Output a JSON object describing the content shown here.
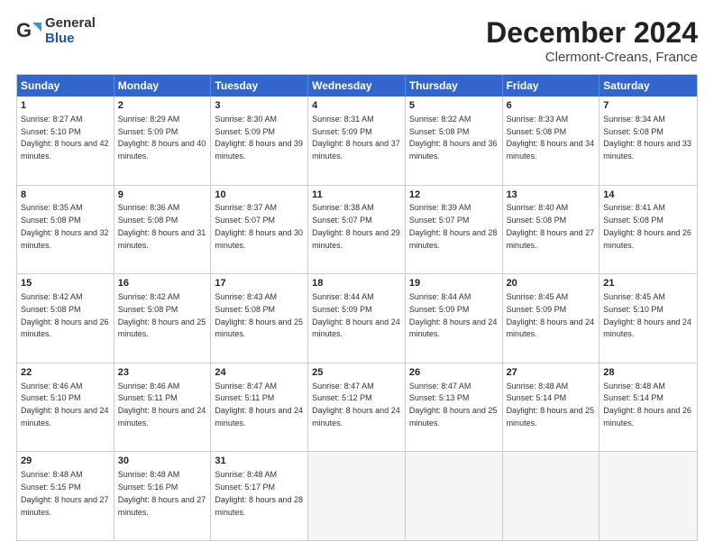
{
  "logo": {
    "general": "General",
    "blue": "Blue"
  },
  "title": "December 2024",
  "subtitle": "Clermont-Creans, France",
  "days": [
    "Sunday",
    "Monday",
    "Tuesday",
    "Wednesday",
    "Thursday",
    "Friday",
    "Saturday"
  ],
  "weeks": [
    [
      {
        "day": "1",
        "sunrise": "8:27 AM",
        "sunset": "5:10 PM",
        "daylight": "8 hours and 42 minutes."
      },
      {
        "day": "2",
        "sunrise": "8:29 AM",
        "sunset": "5:09 PM",
        "daylight": "8 hours and 40 minutes."
      },
      {
        "day": "3",
        "sunrise": "8:30 AM",
        "sunset": "5:09 PM",
        "daylight": "8 hours and 39 minutes."
      },
      {
        "day": "4",
        "sunrise": "8:31 AM",
        "sunset": "5:09 PM",
        "daylight": "8 hours and 37 minutes."
      },
      {
        "day": "5",
        "sunrise": "8:32 AM",
        "sunset": "5:08 PM",
        "daylight": "8 hours and 36 minutes."
      },
      {
        "day": "6",
        "sunrise": "8:33 AM",
        "sunset": "5:08 PM",
        "daylight": "8 hours and 34 minutes."
      },
      {
        "day": "7",
        "sunrise": "8:34 AM",
        "sunset": "5:08 PM",
        "daylight": "8 hours and 33 minutes."
      }
    ],
    [
      {
        "day": "8",
        "sunrise": "8:35 AM",
        "sunset": "5:08 PM",
        "daylight": "8 hours and 32 minutes."
      },
      {
        "day": "9",
        "sunrise": "8:36 AM",
        "sunset": "5:08 PM",
        "daylight": "8 hours and 31 minutes."
      },
      {
        "day": "10",
        "sunrise": "8:37 AM",
        "sunset": "5:07 PM",
        "daylight": "8 hours and 30 minutes."
      },
      {
        "day": "11",
        "sunrise": "8:38 AM",
        "sunset": "5:07 PM",
        "daylight": "8 hours and 29 minutes."
      },
      {
        "day": "12",
        "sunrise": "8:39 AM",
        "sunset": "5:07 PM",
        "daylight": "8 hours and 28 minutes."
      },
      {
        "day": "13",
        "sunrise": "8:40 AM",
        "sunset": "5:08 PM",
        "daylight": "8 hours and 27 minutes."
      },
      {
        "day": "14",
        "sunrise": "8:41 AM",
        "sunset": "5:08 PM",
        "daylight": "8 hours and 26 minutes."
      }
    ],
    [
      {
        "day": "15",
        "sunrise": "8:42 AM",
        "sunset": "5:08 PM",
        "daylight": "8 hours and 26 minutes."
      },
      {
        "day": "16",
        "sunrise": "8:42 AM",
        "sunset": "5:08 PM",
        "daylight": "8 hours and 25 minutes."
      },
      {
        "day": "17",
        "sunrise": "8:43 AM",
        "sunset": "5:08 PM",
        "daylight": "8 hours and 25 minutes."
      },
      {
        "day": "18",
        "sunrise": "8:44 AM",
        "sunset": "5:09 PM",
        "daylight": "8 hours and 24 minutes."
      },
      {
        "day": "19",
        "sunrise": "8:44 AM",
        "sunset": "5:09 PM",
        "daylight": "8 hours and 24 minutes."
      },
      {
        "day": "20",
        "sunrise": "8:45 AM",
        "sunset": "5:09 PM",
        "daylight": "8 hours and 24 minutes."
      },
      {
        "day": "21",
        "sunrise": "8:45 AM",
        "sunset": "5:10 PM",
        "daylight": "8 hours and 24 minutes."
      }
    ],
    [
      {
        "day": "22",
        "sunrise": "8:46 AM",
        "sunset": "5:10 PM",
        "daylight": "8 hours and 24 minutes."
      },
      {
        "day": "23",
        "sunrise": "8:46 AM",
        "sunset": "5:11 PM",
        "daylight": "8 hours and 24 minutes."
      },
      {
        "day": "24",
        "sunrise": "8:47 AM",
        "sunset": "5:11 PM",
        "daylight": "8 hours and 24 minutes."
      },
      {
        "day": "25",
        "sunrise": "8:47 AM",
        "sunset": "5:12 PM",
        "daylight": "8 hours and 24 minutes."
      },
      {
        "day": "26",
        "sunrise": "8:47 AM",
        "sunset": "5:13 PM",
        "daylight": "8 hours and 25 minutes."
      },
      {
        "day": "27",
        "sunrise": "8:48 AM",
        "sunset": "5:14 PM",
        "daylight": "8 hours and 25 minutes."
      },
      {
        "day": "28",
        "sunrise": "8:48 AM",
        "sunset": "5:14 PM",
        "daylight": "8 hours and 26 minutes."
      }
    ],
    [
      {
        "day": "29",
        "sunrise": "8:48 AM",
        "sunset": "5:15 PM",
        "daylight": "8 hours and 27 minutes."
      },
      {
        "day": "30",
        "sunrise": "8:48 AM",
        "sunset": "5:16 PM",
        "daylight": "8 hours and 27 minutes."
      },
      {
        "day": "31",
        "sunrise": "8:48 AM",
        "sunset": "5:17 PM",
        "daylight": "8 hours and 28 minutes."
      },
      null,
      null,
      null,
      null
    ]
  ]
}
